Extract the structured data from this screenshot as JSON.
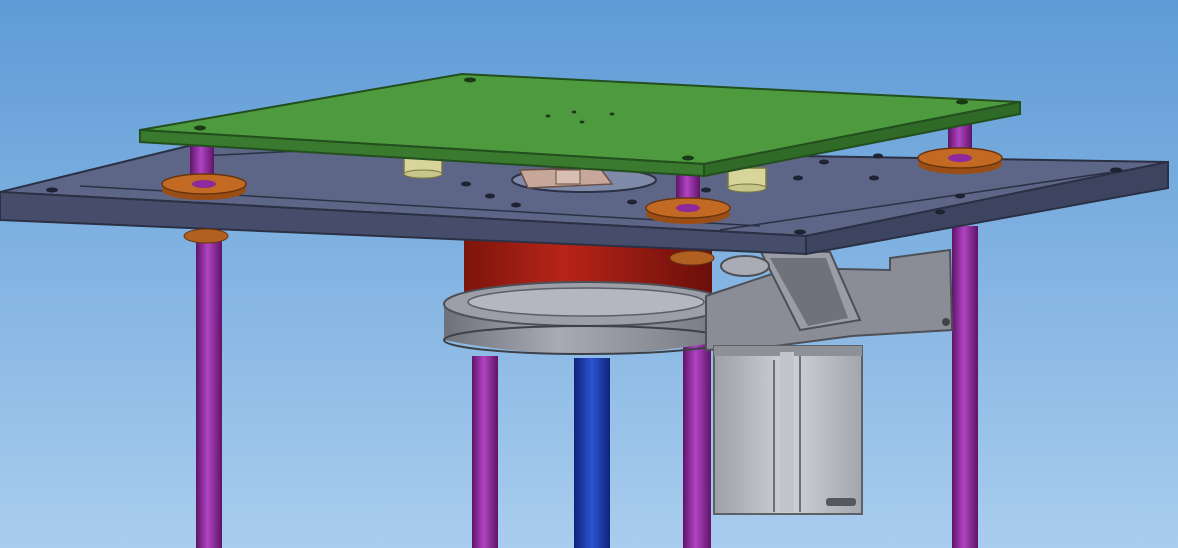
{
  "scene": {
    "kind": "cad-3d-render",
    "background": {
      "top_color": "#5e9bd6",
      "bottom_color": "#a9cdee"
    },
    "colors": {
      "top_plate": "#4e9a3e",
      "top_plate_edge": "#2e6a2a",
      "base_plate": "#5d6686",
      "base_plate_front": "#454d6a",
      "rod": "#8e2a9c",
      "rod_highlight": "#c24fd0",
      "center_shaft": "#1f3fa8",
      "flange": "#c26a24",
      "motor_housing": "#a01f14",
      "pulley": "#8a8d96",
      "stepper_motor": "#b9bcc2",
      "bracket": "#7a7d86",
      "spacer": "#d7d59a",
      "hub": "#c6a79a"
    }
  }
}
